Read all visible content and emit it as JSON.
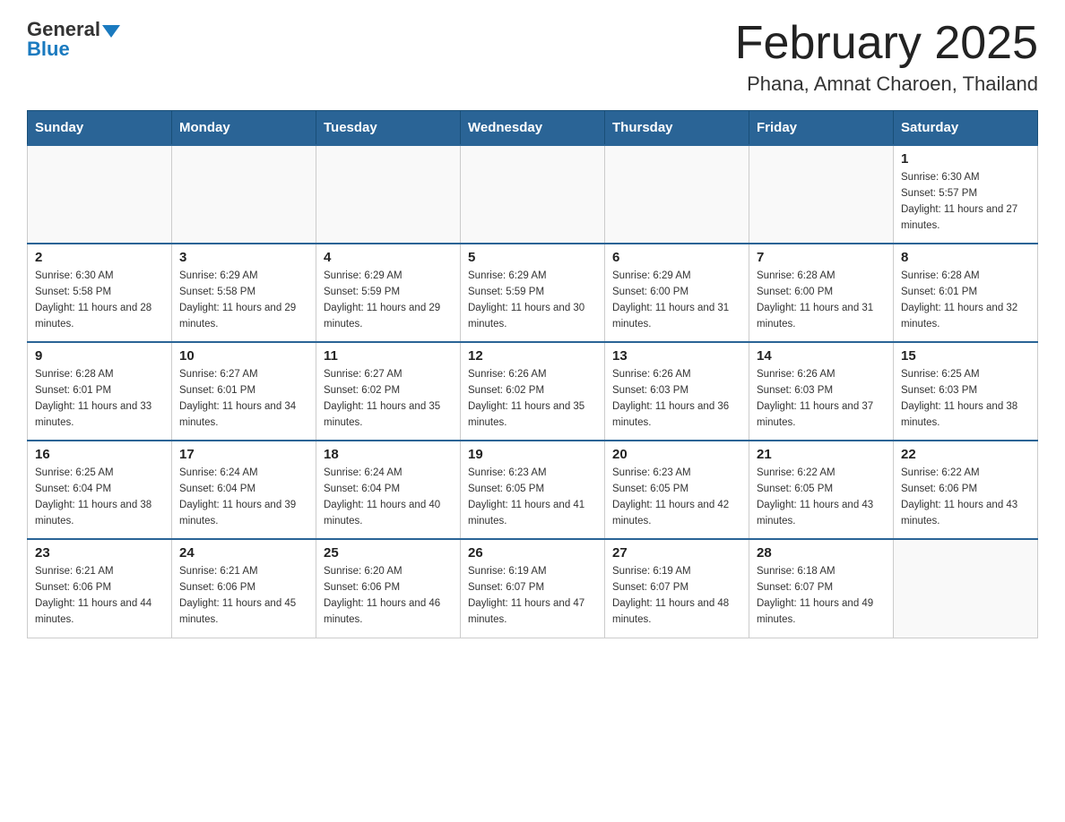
{
  "header": {
    "logo": {
      "general": "General",
      "blue": "Blue"
    },
    "title": "February 2025",
    "location": "Phana, Amnat Charoen, Thailand"
  },
  "weekdays": [
    "Sunday",
    "Monday",
    "Tuesday",
    "Wednesday",
    "Thursday",
    "Friday",
    "Saturday"
  ],
  "weeks": [
    [
      {
        "day": "",
        "sunrise": "",
        "sunset": "",
        "daylight": ""
      },
      {
        "day": "",
        "sunrise": "",
        "sunset": "",
        "daylight": ""
      },
      {
        "day": "",
        "sunrise": "",
        "sunset": "",
        "daylight": ""
      },
      {
        "day": "",
        "sunrise": "",
        "sunset": "",
        "daylight": ""
      },
      {
        "day": "",
        "sunrise": "",
        "sunset": "",
        "daylight": ""
      },
      {
        "day": "",
        "sunrise": "",
        "sunset": "",
        "daylight": ""
      },
      {
        "day": "1",
        "sunrise": "Sunrise: 6:30 AM",
        "sunset": "Sunset: 5:57 PM",
        "daylight": "Daylight: 11 hours and 27 minutes."
      }
    ],
    [
      {
        "day": "2",
        "sunrise": "Sunrise: 6:30 AM",
        "sunset": "Sunset: 5:58 PM",
        "daylight": "Daylight: 11 hours and 28 minutes."
      },
      {
        "day": "3",
        "sunrise": "Sunrise: 6:29 AM",
        "sunset": "Sunset: 5:58 PM",
        "daylight": "Daylight: 11 hours and 29 minutes."
      },
      {
        "day": "4",
        "sunrise": "Sunrise: 6:29 AM",
        "sunset": "Sunset: 5:59 PM",
        "daylight": "Daylight: 11 hours and 29 minutes."
      },
      {
        "day": "5",
        "sunrise": "Sunrise: 6:29 AM",
        "sunset": "Sunset: 5:59 PM",
        "daylight": "Daylight: 11 hours and 30 minutes."
      },
      {
        "day": "6",
        "sunrise": "Sunrise: 6:29 AM",
        "sunset": "Sunset: 6:00 PM",
        "daylight": "Daylight: 11 hours and 31 minutes."
      },
      {
        "day": "7",
        "sunrise": "Sunrise: 6:28 AM",
        "sunset": "Sunset: 6:00 PM",
        "daylight": "Daylight: 11 hours and 31 minutes."
      },
      {
        "day": "8",
        "sunrise": "Sunrise: 6:28 AM",
        "sunset": "Sunset: 6:01 PM",
        "daylight": "Daylight: 11 hours and 32 minutes."
      }
    ],
    [
      {
        "day": "9",
        "sunrise": "Sunrise: 6:28 AM",
        "sunset": "Sunset: 6:01 PM",
        "daylight": "Daylight: 11 hours and 33 minutes."
      },
      {
        "day": "10",
        "sunrise": "Sunrise: 6:27 AM",
        "sunset": "Sunset: 6:01 PM",
        "daylight": "Daylight: 11 hours and 34 minutes."
      },
      {
        "day": "11",
        "sunrise": "Sunrise: 6:27 AM",
        "sunset": "Sunset: 6:02 PM",
        "daylight": "Daylight: 11 hours and 35 minutes."
      },
      {
        "day": "12",
        "sunrise": "Sunrise: 6:26 AM",
        "sunset": "Sunset: 6:02 PM",
        "daylight": "Daylight: 11 hours and 35 minutes."
      },
      {
        "day": "13",
        "sunrise": "Sunrise: 6:26 AM",
        "sunset": "Sunset: 6:03 PM",
        "daylight": "Daylight: 11 hours and 36 minutes."
      },
      {
        "day": "14",
        "sunrise": "Sunrise: 6:26 AM",
        "sunset": "Sunset: 6:03 PM",
        "daylight": "Daylight: 11 hours and 37 minutes."
      },
      {
        "day": "15",
        "sunrise": "Sunrise: 6:25 AM",
        "sunset": "Sunset: 6:03 PM",
        "daylight": "Daylight: 11 hours and 38 minutes."
      }
    ],
    [
      {
        "day": "16",
        "sunrise": "Sunrise: 6:25 AM",
        "sunset": "Sunset: 6:04 PM",
        "daylight": "Daylight: 11 hours and 38 minutes."
      },
      {
        "day": "17",
        "sunrise": "Sunrise: 6:24 AM",
        "sunset": "Sunset: 6:04 PM",
        "daylight": "Daylight: 11 hours and 39 minutes."
      },
      {
        "day": "18",
        "sunrise": "Sunrise: 6:24 AM",
        "sunset": "Sunset: 6:04 PM",
        "daylight": "Daylight: 11 hours and 40 minutes."
      },
      {
        "day": "19",
        "sunrise": "Sunrise: 6:23 AM",
        "sunset": "Sunset: 6:05 PM",
        "daylight": "Daylight: 11 hours and 41 minutes."
      },
      {
        "day": "20",
        "sunrise": "Sunrise: 6:23 AM",
        "sunset": "Sunset: 6:05 PM",
        "daylight": "Daylight: 11 hours and 42 minutes."
      },
      {
        "day": "21",
        "sunrise": "Sunrise: 6:22 AM",
        "sunset": "Sunset: 6:05 PM",
        "daylight": "Daylight: 11 hours and 43 minutes."
      },
      {
        "day": "22",
        "sunrise": "Sunrise: 6:22 AM",
        "sunset": "Sunset: 6:06 PM",
        "daylight": "Daylight: 11 hours and 43 minutes."
      }
    ],
    [
      {
        "day": "23",
        "sunrise": "Sunrise: 6:21 AM",
        "sunset": "Sunset: 6:06 PM",
        "daylight": "Daylight: 11 hours and 44 minutes."
      },
      {
        "day": "24",
        "sunrise": "Sunrise: 6:21 AM",
        "sunset": "Sunset: 6:06 PM",
        "daylight": "Daylight: 11 hours and 45 minutes."
      },
      {
        "day": "25",
        "sunrise": "Sunrise: 6:20 AM",
        "sunset": "Sunset: 6:06 PM",
        "daylight": "Daylight: 11 hours and 46 minutes."
      },
      {
        "day": "26",
        "sunrise": "Sunrise: 6:19 AM",
        "sunset": "Sunset: 6:07 PM",
        "daylight": "Daylight: 11 hours and 47 minutes."
      },
      {
        "day": "27",
        "sunrise": "Sunrise: 6:19 AM",
        "sunset": "Sunset: 6:07 PM",
        "daylight": "Daylight: 11 hours and 48 minutes."
      },
      {
        "day": "28",
        "sunrise": "Sunrise: 6:18 AM",
        "sunset": "Sunset: 6:07 PM",
        "daylight": "Daylight: 11 hours and 49 minutes."
      },
      {
        "day": "",
        "sunrise": "",
        "sunset": "",
        "daylight": ""
      }
    ]
  ]
}
